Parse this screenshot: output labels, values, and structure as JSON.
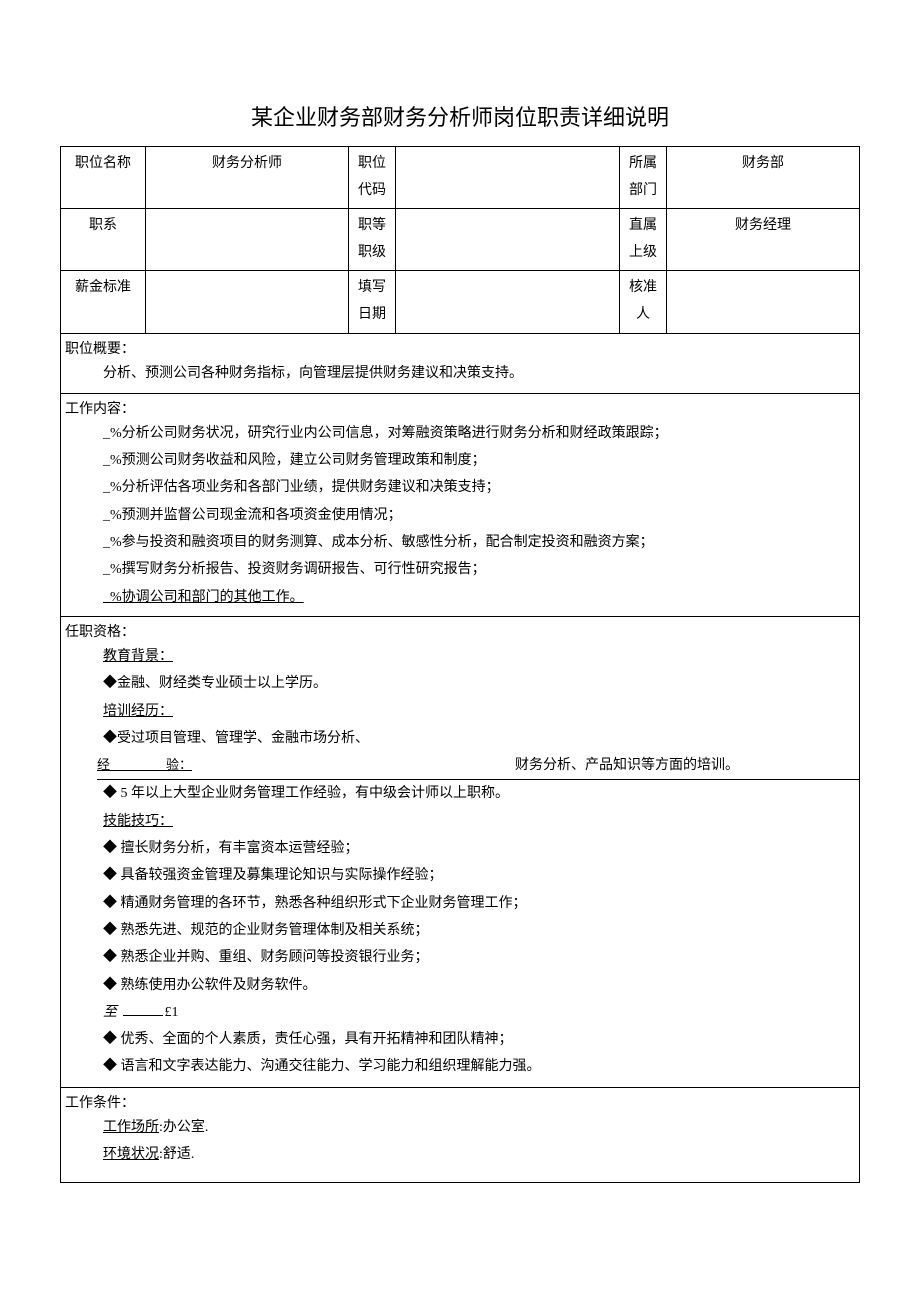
{
  "title": "某企业财务部财务分析师岗位职责详细说明",
  "header": {
    "r1": {
      "c1_label": "职位名称",
      "c1_value": "财务分析师",
      "c2_label": "职位代码",
      "c2_value": "",
      "c3_label": "所属部门",
      "c3_value": "财务部"
    },
    "r2": {
      "c1_label": "职系",
      "c1_value": "",
      "c2_label": "职等职级",
      "c2_value": "",
      "c3_label": "直属上级",
      "c3_value": "财务经理"
    },
    "r3": {
      "c1_label": "薪金标准",
      "c1_value": "",
      "c2_label": "填写日期",
      "c2_value": "",
      "c3_label": "核准人",
      "c3_value": ""
    }
  },
  "overview": {
    "label": "职位概要：",
    "text": "分析、预测公司各种财务指标，向管理层提供财务建议和决策支持。"
  },
  "work": {
    "label": "工作内容：",
    "items": [
      "_%分析公司财务状况，研究行业内公司信息，对筹融资策略进行财务分析和财经政策跟踪；",
      "_%预测公司财务收益和风险，建立公司财务管理政策和制度；",
      "_%分析评估各项业务和各部门业绩，提供财务建议和决策支持；",
      "_%预测并监督公司现金流和各项资金使用情况；",
      "_%参与投资和融资项目的财务测算、成本分析、敏感性分析，配合制定投资和融资方案；",
      "_%撰写财务分析报告、投资财务调研报告、可行性研究报告；",
      "_%协调公司和部门的其他工作。"
    ]
  },
  "qual": {
    "label": "任职资格：",
    "edu_label": "教育背景：",
    "edu_item": "◆金融、财经类专业硕士以上学历。",
    "train_label": "培训经历：",
    "train_left": "◆受过项目管理、管理学、金融市场分析、",
    "train_right": "财务分析、产品知识等方面的培训。",
    "exp_label": "经验：",
    "exp_item": "◆ 5 年以上大型企业财务管理工作经验，有中级会计师以上职称。",
    "skill_label": "技能技巧：",
    "skill_items": [
      "◆ 擅长财务分析，有丰富资本运营经验；",
      "◆ 具备较强资金管理及募集理论知识与实际操作经验；",
      "◆ 精通财务管理的各环节，熟悉各种组织形式下企业财务管理工作；",
      "◆ 熟悉先进、规范的企业财务管理体制及相关系统；",
      "◆ 熟悉企业并购、重组、财务顾问等投资银行业务；",
      "◆ 熟练使用办公软件及财务软件。"
    ],
    "strange_line": "至 ______£1",
    "trait_items": [
      "◆ 优秀、全面的个人素质，责任心强，具有开拓精神和团队精神；",
      "◆ 语言和文字表达能力、沟通交往能力、学习能力和组织理解能力强。"
    ]
  },
  "cond": {
    "label": "工作条件：",
    "place_label": "工作场所",
    "place_value": ":办公室.",
    "env_label": "环境状况",
    "env_value": ":舒适."
  }
}
